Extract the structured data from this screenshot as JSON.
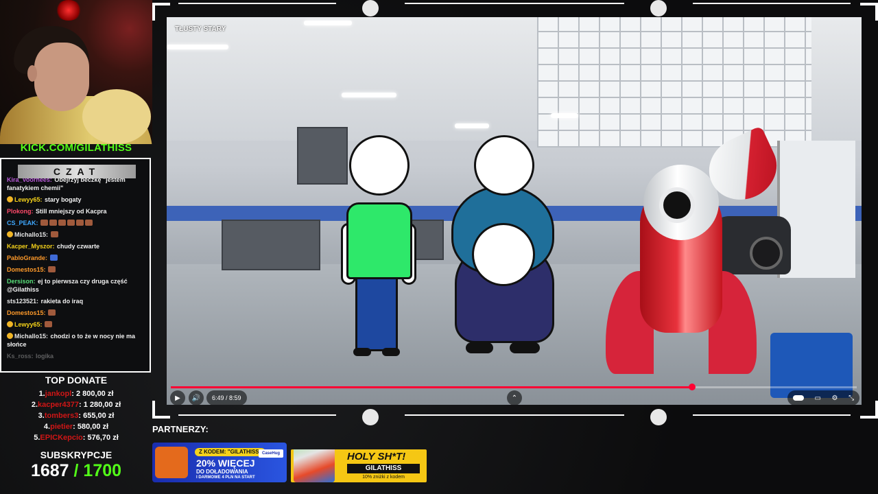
{
  "stream": {
    "kick_url": "KICK.COM/GILATHISS"
  },
  "chat": {
    "header": "CZAT",
    "messages": [
      {
        "user": "Kira_Voorhees:",
        "text": "Obejrzyj beczkę \"jestem fanatykiem chemii\"",
        "user_color": "#b85ad8",
        "badge": false,
        "emote": "",
        "faded": false
      },
      {
        "user": "Lewyy65:",
        "text": "stary bogaty",
        "user_color": "#f5d21a",
        "badge": true,
        "emote": "",
        "faded": false
      },
      {
        "user": "Plokong:",
        "text": "Still mniejszy od Kacpra",
        "user_color": "#ff4a6a",
        "badge": false,
        "emote": "",
        "faded": false
      },
      {
        "user": "CS_PEAK:",
        "text": "",
        "user_color": "#3fa9ff",
        "badge": false,
        "emote": "x6",
        "faded": false
      },
      {
        "user": "Michallo15:",
        "text": "",
        "user_color": "#e8e8e8",
        "badge": true,
        "emote": "x1",
        "faded": false
      },
      {
        "user": "Kacper_Myszor:",
        "text": "chudy czwarte",
        "user_color": "#f5d21a",
        "badge": false,
        "emote": "",
        "faded": false
      },
      {
        "user": "PabloGrande:",
        "text": "",
        "user_color": "#ff9a2a",
        "badge": false,
        "emote": "blue",
        "faded": false
      },
      {
        "user": "Domestos15:",
        "text": "",
        "user_color": "#ff9a2a",
        "badge": false,
        "emote": "x1",
        "faded": false
      },
      {
        "user": "Dersison:",
        "text": "ej to pierwsza czy druga część @Gilathiss",
        "user_color": "#5ae07a",
        "badge": false,
        "emote": "",
        "faded": false
      },
      {
        "user": "sts123521:",
        "text": "rakieta do iraq",
        "user_color": "#e8e8e8",
        "badge": false,
        "emote": "",
        "faded": false
      },
      {
        "user": "Domestos15:",
        "text": "",
        "user_color": "#ff9a2a",
        "badge": false,
        "emote": "x1",
        "faded": false
      },
      {
        "user": "Lewyy65:",
        "text": "",
        "user_color": "#f5d21a",
        "badge": true,
        "emote": "x1",
        "faded": false
      },
      {
        "user": "Michallo15:",
        "text": "chodzi o to że w nocy nie ma słońce",
        "user_color": "#e8e8e8",
        "badge": true,
        "emote": "",
        "faded": false
      },
      {
        "user": "Ks_ross:",
        "text": "logika",
        "user_color": "#e8e8e8",
        "badge": false,
        "emote": "",
        "faded": true
      }
    ]
  },
  "top_donate": {
    "title": "TOP DONATE",
    "items": [
      {
        "rank": "1.",
        "name": "jankopl",
        "amount": ": 2 800,00 zł"
      },
      {
        "rank": "2.",
        "name": "kacper4377",
        "amount": ": 1 280,00 zł"
      },
      {
        "rank": "3.",
        "name": "tombers3",
        "amount": ": 655,00 zł"
      },
      {
        "rank": "4.",
        "name": "pietier",
        "amount": ": 580,00 zł"
      },
      {
        "rank": "5.",
        "name": "EPICKepcio",
        "amount": ": 576,70 zł"
      }
    ]
  },
  "subs": {
    "title": "SUBSKRYPCJE",
    "current": "1687",
    "goal": "/ 1700",
    "progress_fraction": 0.992
  },
  "video": {
    "title": "TŁUSTY STARY",
    "time": "6:49 / 8:59",
    "progress_fraction": 0.76
  },
  "partners": {
    "label": "PARTNERZY:",
    "ad1": {
      "code": "Z KODEM: \"GILATHISS\"",
      "brand": "CaseHug",
      "big": "20% WIĘCEJ",
      "sub": "DO DOŁADOWANIA",
      "small": "I DARMOWE 4 PLN NA START"
    },
    "ad2": {
      "brand": "HOLY SH*T!",
      "code": "GILATHISS",
      "note": "10% zniżki z kodem"
    }
  },
  "colors": {
    "kick_green": "#53fc18",
    "donor_red": "#d01616",
    "progress_red": "#ff0033"
  }
}
